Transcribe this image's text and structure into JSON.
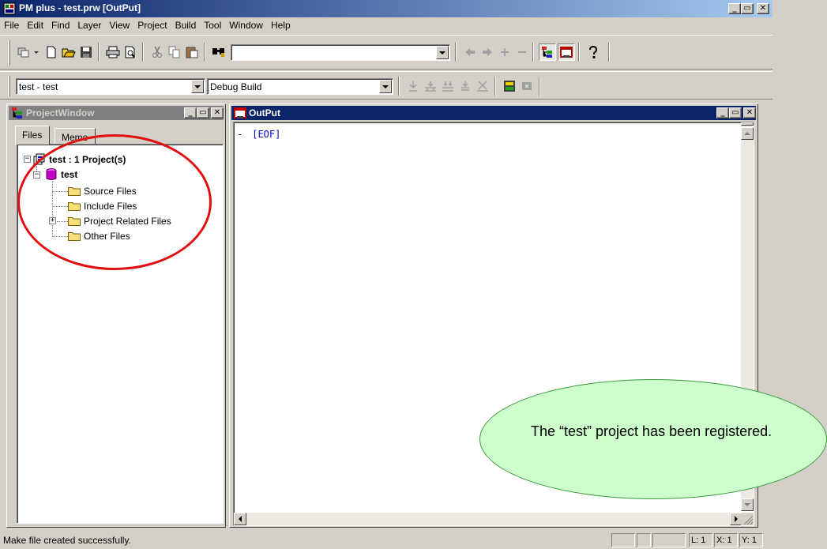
{
  "window": {
    "title": "PM plus - test.prw [OutPut]",
    "min_glyph": "_",
    "restore_glyph": "▭",
    "close_glyph": "✕"
  },
  "menu": [
    "File",
    "Edit",
    "Find",
    "Layer",
    "View",
    "Project",
    "Build",
    "Tool",
    "Window",
    "Help"
  ],
  "toolbar1": {
    "find_combo_value": "",
    "icons": [
      "project-icon",
      "new-file-icon",
      "open-icon",
      "save-icon",
      "print-icon",
      "print-preview-icon",
      "cut-icon",
      "copy-icon",
      "paste-icon",
      "find-icon",
      "back-icon",
      "forward-icon",
      "add-icon",
      "remove-icon",
      "project-window-icon",
      "output-window-icon",
      "help-icon"
    ]
  },
  "toolbar2": {
    "project_combo": "test - test",
    "build_combo": "Debug Build"
  },
  "project_window": {
    "title": "ProjectWindow",
    "tabs": [
      "Files",
      "Memo"
    ],
    "tree": {
      "root": "test : 1 Project(s)",
      "project": "test",
      "folders": [
        "Source Files",
        "Include Files",
        "Project Related Files",
        "Other Files"
      ]
    }
  },
  "output_window": {
    "title": "OutPut",
    "lines": [
      "[EOF]"
    ]
  },
  "status": {
    "message": "Make file created successfully.",
    "line": "L: 1",
    "col": "X: 1",
    "row": "Y: 1"
  },
  "annotation": {
    "callout_text": "The “test” project has been registered."
  },
  "colors": {
    "titlebar": "#0a246a",
    "face": "#d4d0c8",
    "highlight_ring": "#e01010",
    "callout_fill": "#ccffcc",
    "eof_text": "#0000c0"
  }
}
